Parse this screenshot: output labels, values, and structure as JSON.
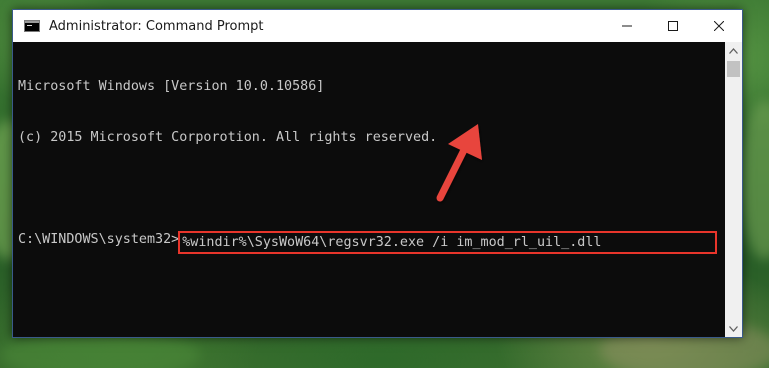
{
  "window": {
    "title": "Administrator: Command Prompt"
  },
  "console": {
    "lines": [
      "Microsoft Windows [Version 10.0.10586]",
      "(c) 2015 Microsoft Corporotion. All rights reserved."
    ],
    "prompt": "C:\\WINDOWS\\system32>",
    "command": "%windir%\\SysWoW64\\regsvr32.exe /i im_mod_rl_uil_.dll"
  },
  "colors": {
    "highlight_border": "#e8352b",
    "annotation_arrow": "#e8453c",
    "console_bg": "#0c0c0c",
    "console_text": "#c8c8c8"
  },
  "icons": {
    "app": "cmd-icon",
    "minimize": "minimize-icon",
    "maximize": "maximize-icon",
    "close": "close-icon",
    "scroll_up": "scroll-up-icon",
    "scroll_down": "scroll-down-icon",
    "annotation": "red-arrow-icon"
  }
}
